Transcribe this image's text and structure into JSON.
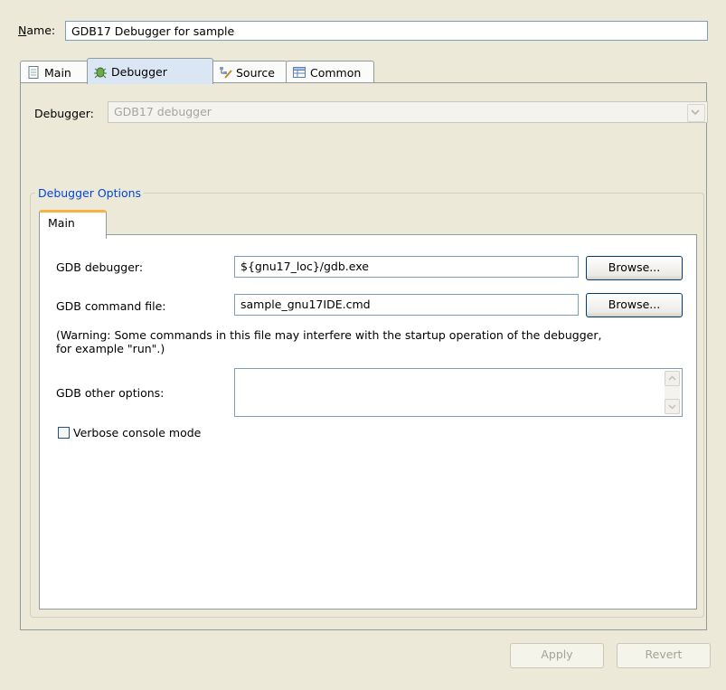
{
  "name_row": {
    "label": "Name:",
    "value": "GDB17 Debugger for sample"
  },
  "tabs": [
    {
      "label": "Main",
      "icon": "document-icon",
      "selected": false
    },
    {
      "label": "Debugger",
      "icon": "bug-icon",
      "selected": true
    },
    {
      "label": "Source",
      "icon": "source-lookup-icon",
      "selected": false
    },
    {
      "label": "Common",
      "icon": "common-table-icon",
      "selected": false
    }
  ],
  "debugger": {
    "label": "Debugger:",
    "selected_value": "GDB17 debugger",
    "enabled": false
  },
  "debugger_options": {
    "group_title": "Debugger Options",
    "inner_tab": "Main",
    "gdb_debugger": {
      "label": "GDB debugger:",
      "value": "${gnu17_loc}/gdb.exe",
      "browse_label": "Browse..."
    },
    "gdb_command_file": {
      "label": "GDB command file:",
      "value": "sample_gnu17IDE.cmd",
      "browse_label": "Browse..."
    },
    "warning_line1": "(Warning: Some commands in this file may interfere with the startup operation of the debugger,",
    "warning_line2": "for example \"run\".)",
    "gdb_other_options": {
      "label": "GDB other options:",
      "value": ""
    },
    "verbose": {
      "label": "Verbose console mode",
      "checked": false
    }
  },
  "footer": {
    "apply_label": "Apply",
    "revert_label": "Revert"
  },
  "colors": {
    "background": "#ece9d8",
    "selected_tab": "#dbe6f5",
    "inner_tab_accent": "#f7b53d",
    "group_title": "#0046d5"
  }
}
